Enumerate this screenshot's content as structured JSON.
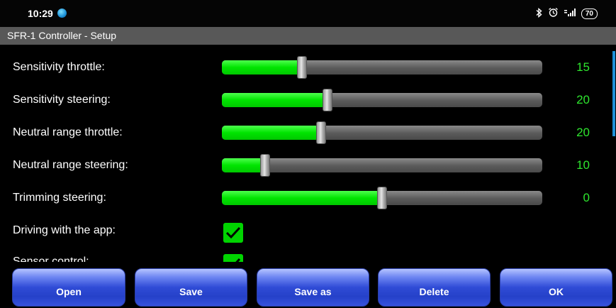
{
  "status_bar": {
    "time": "10:29",
    "battery": "70"
  },
  "title_bar": {
    "title": "SFR-1 Controller - Setup"
  },
  "settings": [
    {
      "label": "Sensitivity throttle:",
      "value": "15",
      "fill_fraction": 0.25
    },
    {
      "label": "Sensitivity steering:",
      "value": "20",
      "fill_fraction": 0.33
    },
    {
      "label": "Neutral range throttle:",
      "value": "20",
      "fill_fraction": 0.31
    },
    {
      "label": "Neutral range steering:",
      "value": "10",
      "fill_fraction": 0.135
    },
    {
      "label": "Trimming steering:",
      "value": "0",
      "fill_fraction": 0.5
    }
  ],
  "checkboxes": [
    {
      "label": "Driving with the app:",
      "checked": true
    },
    {
      "label": "Sensor control:",
      "checked": true
    }
  ],
  "buttons": {
    "open": "Open",
    "save": "Save",
    "save_as": "Save as",
    "delete": "Delete",
    "ok": "OK"
  },
  "colors": {
    "slider_fill": "#00e400",
    "value_text": "#2ee52e",
    "button": "#2f4bd6"
  }
}
